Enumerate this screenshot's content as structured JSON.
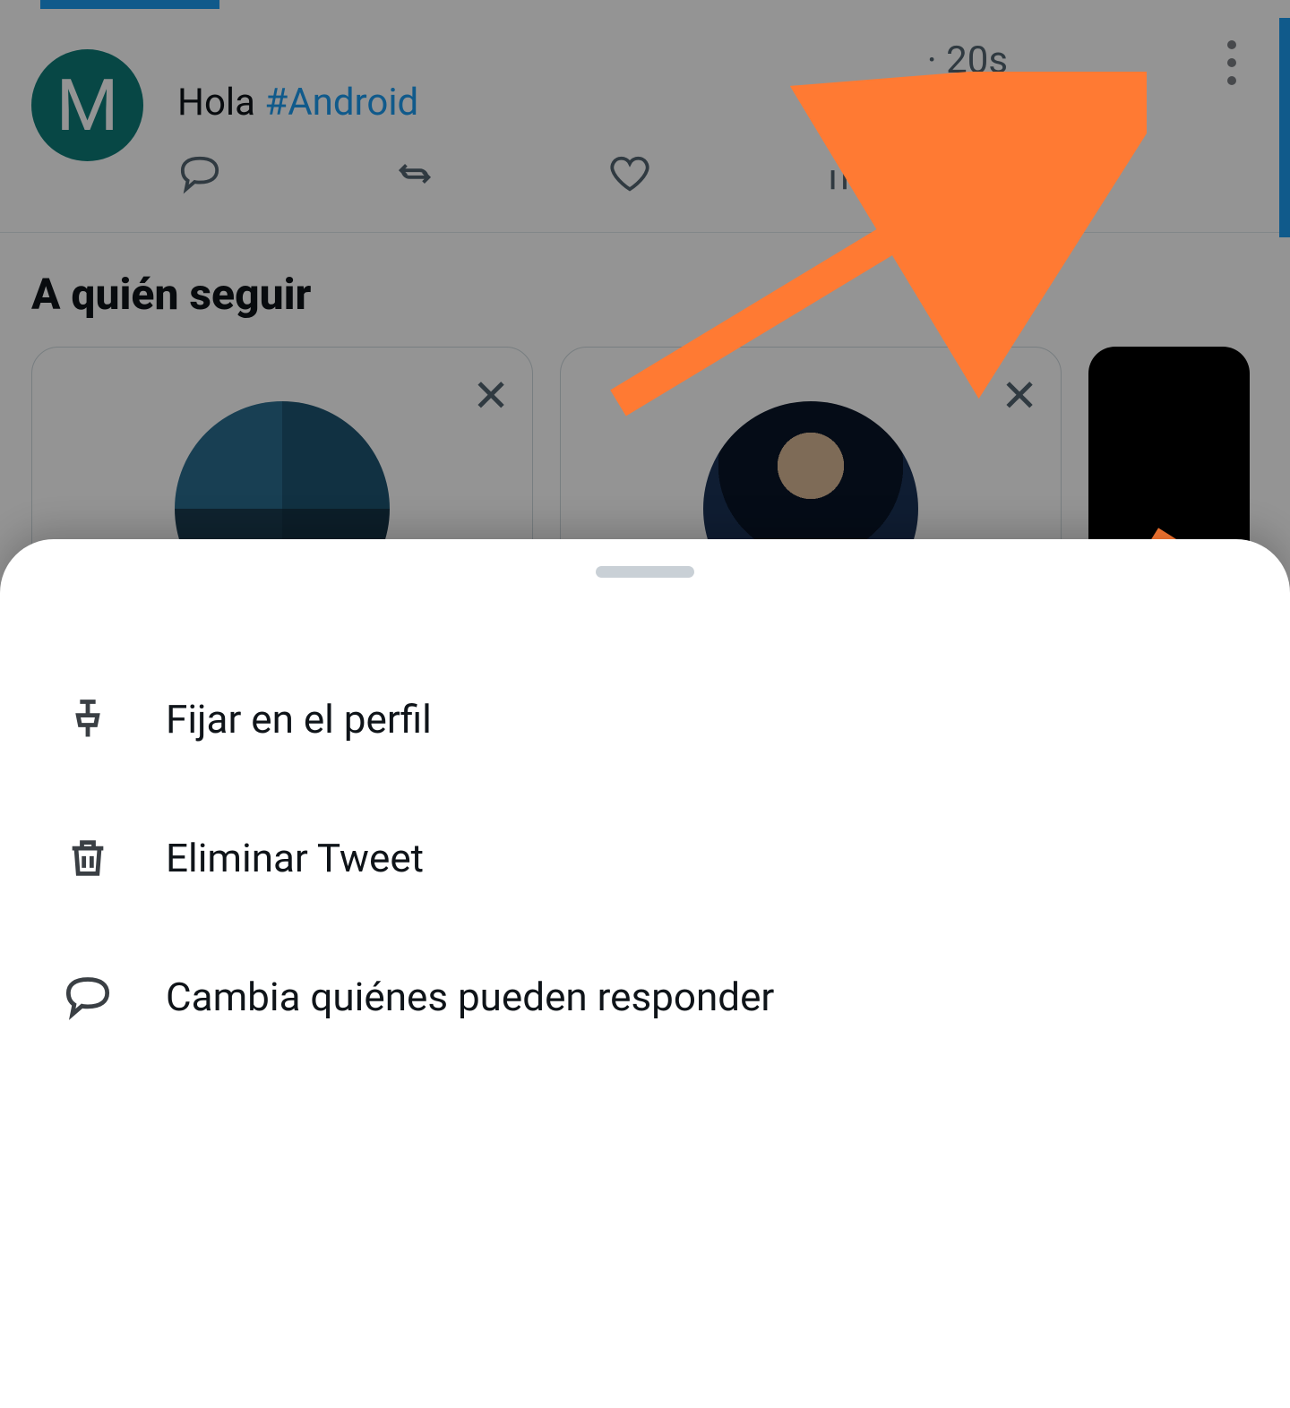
{
  "tweet": {
    "avatar_initial": "M",
    "timestamp": "· 20s",
    "text_plain": "Hola ",
    "hashtag": "#Android"
  },
  "section_title": "A quién seguir",
  "sheet": {
    "pin_label": "Fijar en el perfil",
    "delete_label": "Eliminar Tweet",
    "reply_label": "Cambia quiénes pueden responder"
  },
  "colors": {
    "accent": "#1d9bf0",
    "annotation": "#ff7a33"
  }
}
